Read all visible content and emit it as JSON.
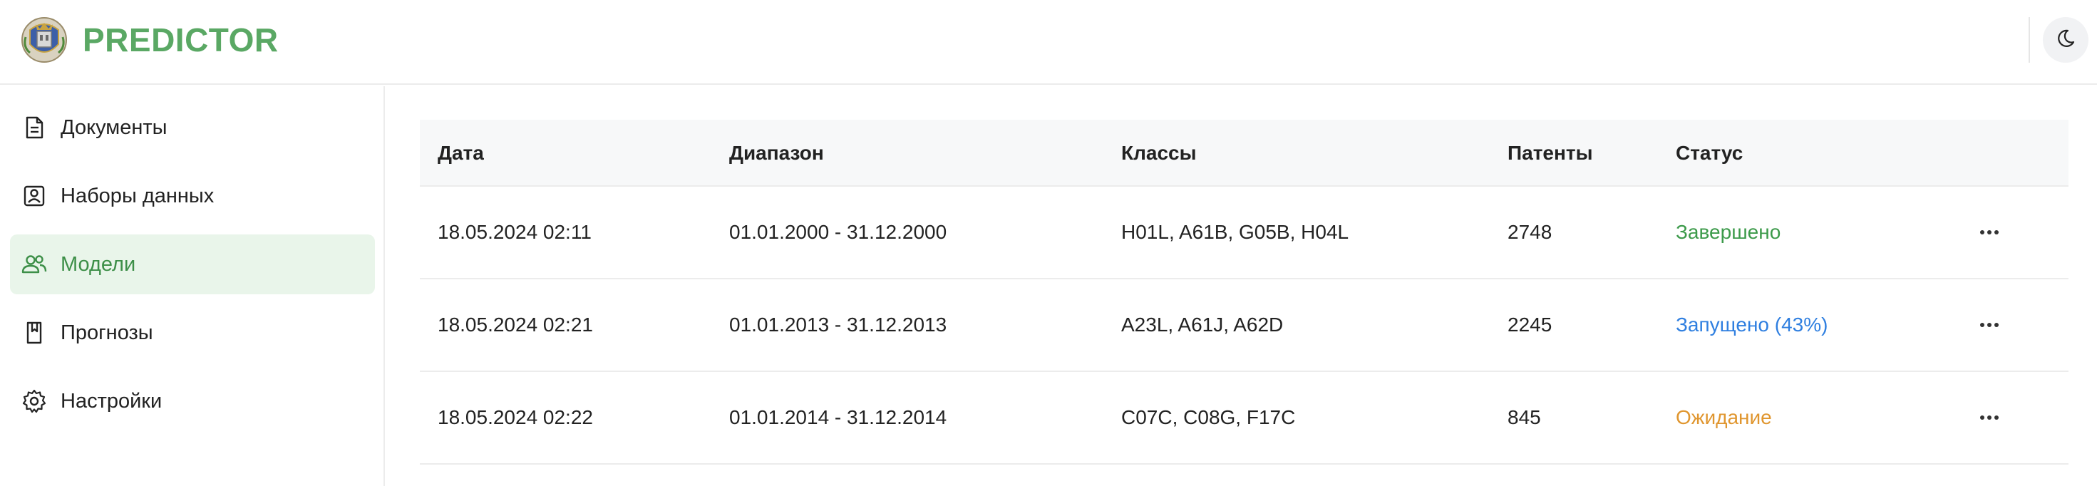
{
  "header": {
    "brand": "PREDICTOR",
    "theme_toggle_icon": "moon-icon"
  },
  "sidebar": {
    "items": [
      {
        "label": "Документы",
        "icon": "document-icon",
        "active": false
      },
      {
        "label": "Наборы данных",
        "icon": "dataset-icon",
        "active": false
      },
      {
        "label": "Модели",
        "icon": "users-icon",
        "active": true
      },
      {
        "label": "Прогнозы",
        "icon": "bookmark-icon",
        "active": false
      },
      {
        "label": "Настройки",
        "icon": "gear-icon",
        "active": false
      }
    ]
  },
  "table": {
    "columns": [
      "Дата",
      "Диапазон",
      "Классы",
      "Патенты",
      "Статус"
    ],
    "rows": [
      {
        "date": "18.05.2024 02:11",
        "range": "01.01.2000 - 31.12.2000",
        "classes": "H01L, A61B, G05B, H04L",
        "patents": "2748",
        "status": "Завершено",
        "status_color": "#3c9a4a"
      },
      {
        "date": "18.05.2024 02:21",
        "range": "01.01.2013 - 31.12.2013",
        "classes": "A23L, A61J, A62D",
        "patents": "2245",
        "status": "Запущено (43%)",
        "status_color": "#2f7fe0"
      },
      {
        "date": "18.05.2024 02:22",
        "range": "01.01.2014 - 31.12.2014",
        "classes": "C07C, C08G, F17C",
        "patents": "845",
        "status": "Ожидание",
        "status_color": "#e0962f"
      }
    ]
  },
  "colors": {
    "brand": "#5aa864",
    "active_bg": "#e9f5ea",
    "active_text": "#3d8f48"
  }
}
